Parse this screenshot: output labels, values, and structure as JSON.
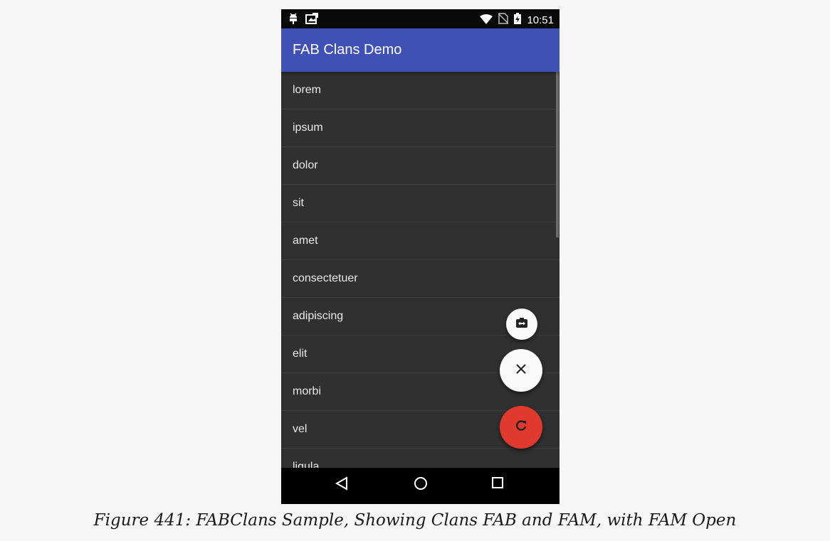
{
  "status_bar": {
    "time": "10:51",
    "left_icons": [
      "android-debug-icon",
      "screenshot-icon"
    ],
    "right_icons": [
      "wifi-icon",
      "no-sim-icon",
      "battery-charging-icon"
    ]
  },
  "app_bar": {
    "title": "FAB Clans Demo",
    "color": "#3f51b5"
  },
  "list": {
    "items": [
      {
        "label": "lorem"
      },
      {
        "label": "ipsum"
      },
      {
        "label": "dolor"
      },
      {
        "label": "sit"
      },
      {
        "label": "amet"
      },
      {
        "label": "consectetuer"
      },
      {
        "label": "adipiscing"
      },
      {
        "label": "elit"
      },
      {
        "label": "morbi"
      },
      {
        "label": "vel"
      },
      {
        "label": "ligula"
      }
    ]
  },
  "fabs": {
    "mini": {
      "icon": "switch-camera-icon",
      "color": "#fafafa"
    },
    "close": {
      "icon": "close-icon",
      "color": "#fafafa"
    },
    "refresh": {
      "icon": "refresh-icon",
      "color": "#e03a2e"
    }
  },
  "nav_bar": {
    "icons": [
      "back-icon",
      "home-icon",
      "recents-icon"
    ]
  },
  "caption": "Figure 441: FABClans Sample, Showing Clans FAB and FAM, with FAM Open"
}
